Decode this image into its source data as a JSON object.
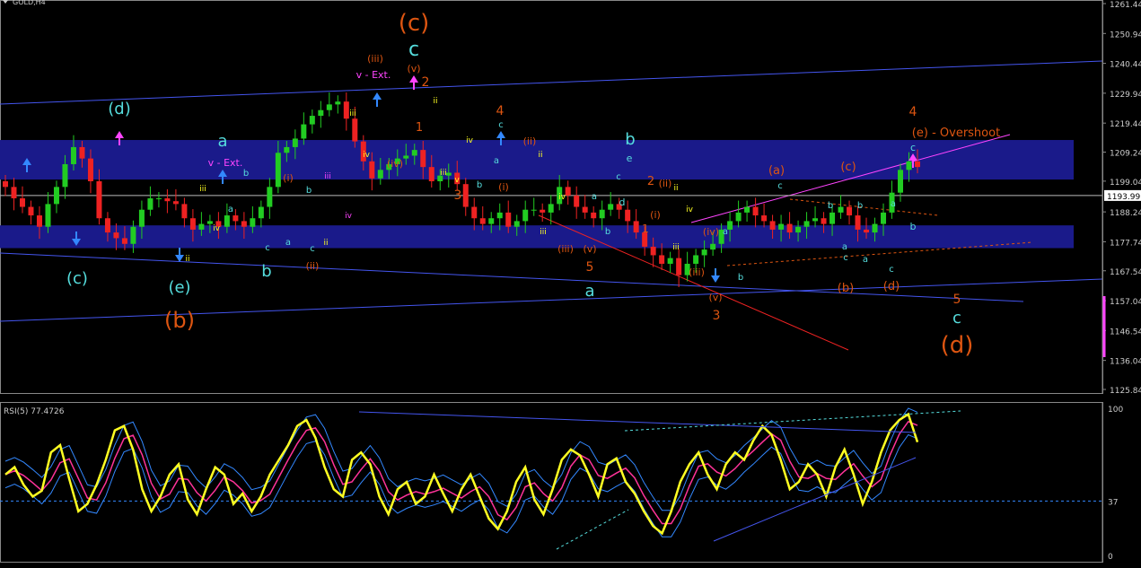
{
  "window": {
    "symbol_label": "GOLD,H4"
  },
  "indicator": {
    "label": "RSI(5) 77.4726"
  },
  "colors": {
    "background": "#000000",
    "bull_candle": "#22cc22",
    "bear_candle": "#ee2222",
    "band_fill": "#1a1a8a",
    "channel_line": "#4455ee",
    "magenta": "#ff44ff",
    "orange": "#dd5511",
    "cyan": "#55dddd",
    "yellow": "#ffff22",
    "rsi_fast": "#ffff22",
    "rsi_signal": "#ff3399",
    "rsi_band": "#3388ff",
    "axis_text": "#cccccc",
    "current_price_line": "#bbbbbb"
  },
  "chart_data": [
    {
      "type": "candlestick",
      "title": "GOLD,H4",
      "y_axis_ticks": [
        "1261.44",
        "1250.94",
        "1240.44",
        "1229.94",
        "1219.44",
        "1209.24",
        "1199.04",
        "1188.24",
        "1177.74",
        "1167.54",
        "1157.04",
        "1146.54",
        "1136.04",
        "1125.84"
      ],
      "current_price": "1193.99",
      "ylim": [
        1125.84,
        1261.44
      ],
      "overlay": "Elliott wave count with supply/demand bands and channel lines",
      "wave_labels": [
        "(c)",
        "c",
        "(d)",
        "a",
        "(b)",
        "(e)",
        "b",
        "(iii)",
        "v - Ext.",
        "(v)",
        "(iv)",
        "2",
        "1",
        "3",
        "4",
        "5",
        "(i)",
        "(ii)",
        "iv",
        "ii",
        "iii",
        "i",
        "v",
        "d",
        "e",
        "(a)",
        "(e) - Overshoot",
        "(d)",
        "(iii)",
        "(iv)",
        "(v)"
      ],
      "approx_close_values": [
        1197,
        1193,
        1190,
        1187,
        1183,
        1191,
        1197,
        1205,
        1211,
        1207,
        1199,
        1186,
        1181,
        1179,
        1177,
        1183,
        1189,
        1193,
        1193,
        1192,
        1191,
        1186,
        1182,
        1184,
        1185,
        1183,
        1187,
        1185,
        1183,
        1186,
        1190,
        1197,
        1209,
        1211,
        1214,
        1219,
        1222,
        1224,
        1226,
        1227,
        1221,
        1213,
        1206,
        1200,
        1203,
        1205,
        1207,
        1208,
        1210,
        1204,
        1199,
        1201,
        1202,
        1198,
        1190,
        1186,
        1184,
        1186,
        1188,
        1183,
        1185,
        1189,
        1189,
        1188,
        1191,
        1197,
        1194,
        1190,
        1188,
        1186,
        1189,
        1191,
        1189,
        1185,
        1181,
        1176,
        1173,
        1170,
        1172,
        1166,
        1170,
        1173,
        1175,
        1177,
        1182,
        1185,
        1188,
        1190,
        1187,
        1185,
        1182,
        1184,
        1181,
        1183,
        1185,
        1186,
        1184,
        1188,
        1190,
        1187,
        1182,
        1181,
        1184,
        1188,
        1195,
        1203,
        1206,
        1204
      ]
    },
    {
      "type": "line",
      "title": "RSI(5) 77.4726",
      "y_axis_ticks": [
        "100",
        "37",
        "0"
      ],
      "ylim": [
        0,
        100
      ],
      "reference_level": 37,
      "series": [
        {
          "name": "RSI(5)",
          "values": [
            55,
            60,
            48,
            40,
            44,
            70,
            75,
            52,
            30,
            35,
            48,
            65,
            85,
            88,
            72,
            45,
            30,
            40,
            55,
            62,
            38,
            28,
            45,
            60,
            55,
            35,
            42,
            30,
            40,
            55,
            65,
            75,
            88,
            92,
            80,
            60,
            45,
            40,
            65,
            70,
            62,
            40,
            28,
            45,
            50,
            35,
            40,
            55,
            42,
            30,
            45,
            55,
            40,
            25,
            18,
            30,
            50,
            60,
            38,
            28,
            45,
            65,
            72,
            68,
            55,
            40,
            62,
            66,
            50,
            42,
            30,
            20,
            15,
            30,
            50,
            62,
            70,
            55,
            45,
            62,
            70,
            65,
            78,
            88,
            82,
            65,
            45,
            50,
            62,
            55,
            40,
            60,
            72,
            55,
            35,
            50,
            70,
            85,
            92,
            96,
            77
          ]
        }
      ]
    }
  ]
}
